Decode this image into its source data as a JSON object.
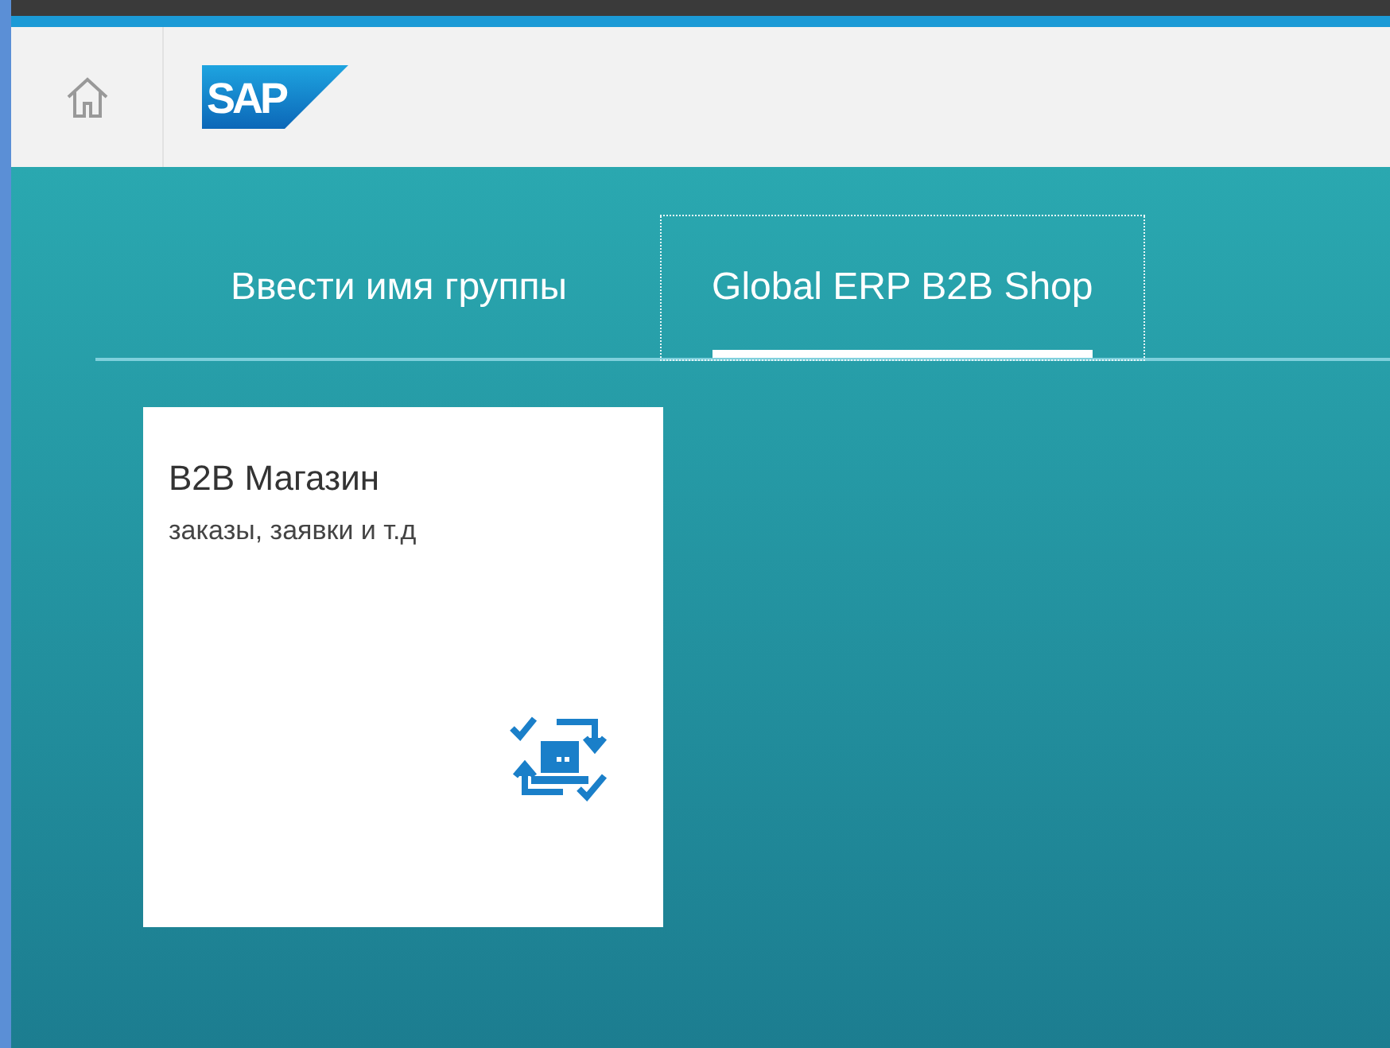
{
  "header": {
    "logo": "SAP"
  },
  "tabs": [
    {
      "label": "Ввести имя группы",
      "selected": false
    },
    {
      "label": "Global ERP B2B Shop",
      "selected": true
    }
  ],
  "tiles": [
    {
      "title": "B2B Магазин",
      "subtitle": "заказы, заявки и т.д"
    }
  ]
}
